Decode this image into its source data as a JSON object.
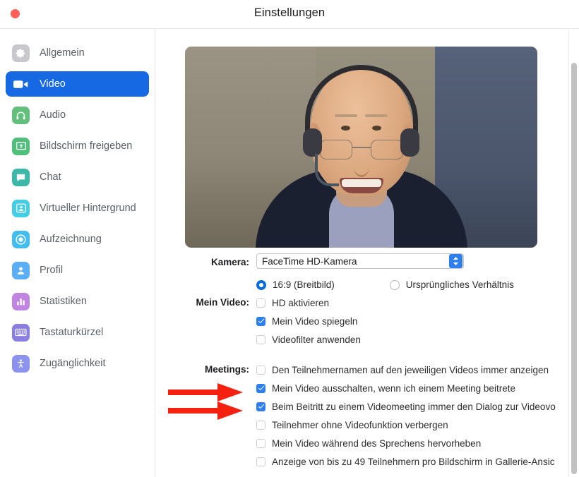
{
  "window": {
    "title": "Einstellungen",
    "close_button_label": "",
    "traffic_light_color": "#ff5f56"
  },
  "sidebar": {
    "items": [
      {
        "label": "Allgemein",
        "icon": "gear-icon",
        "color": "#c8c8cc",
        "active": false
      },
      {
        "label": "Video",
        "icon": "video-camera-icon",
        "color": "#1668e3",
        "active": true
      },
      {
        "label": "Audio",
        "icon": "headphones-icon",
        "color": "#62c07c",
        "active": false
      },
      {
        "label": "Bildschirm freigeben",
        "icon": "share-screen-icon",
        "color": "#4fc07a",
        "active": false
      },
      {
        "label": "Chat",
        "icon": "chat-bubble-icon",
        "color": "#3cb8a8",
        "active": false
      },
      {
        "label": "Virtueller Hintergrund",
        "icon": "virtual-background-icon",
        "color": "#42cfe6",
        "active": false
      },
      {
        "label": "Aufzeichnung",
        "icon": "record-icon",
        "color": "#41bdf0",
        "active": false
      },
      {
        "label": "Profil",
        "icon": "profile-icon",
        "color": "#5aaef5",
        "active": false
      },
      {
        "label": "Statistiken",
        "icon": "statistics-icon",
        "color": "#c085e0",
        "active": false
      },
      {
        "label": "Tastaturkürzel",
        "icon": "keyboard-icon",
        "color": "#8a7fe0",
        "active": false
      },
      {
        "label": "Zugänglichkeit",
        "icon": "accessibility-icon",
        "color": "#8b93ef",
        "active": false
      }
    ]
  },
  "main": {
    "video_preview": {
      "alt": "camera-preview"
    },
    "camera": {
      "label": "Kamera:",
      "selected": "FaceTime HD-Kamera"
    },
    "aspect_ratio": {
      "options": [
        {
          "label": "16:9 (Breitbild)",
          "checked": true
        },
        {
          "label": "Ursprüngliches Verhältnis",
          "checked": false
        }
      ]
    },
    "my_video": {
      "label": "Mein Video:",
      "checkboxes": [
        {
          "label": "HD aktivieren",
          "checked": false
        },
        {
          "label": "Mein Video spiegeln",
          "checked": true
        },
        {
          "label": "Videofilter anwenden",
          "checked": false
        }
      ]
    },
    "meetings": {
      "label": "Meetings:",
      "checkboxes": [
        {
          "label": "Den Teilnehmernamen auf den jeweiligen Videos immer anzeigen",
          "checked": false
        },
        {
          "label": "Mein Video ausschalten, wenn ich einem Meeting beitrete",
          "checked": true
        },
        {
          "label": "Beim Beitritt zu einem Videomeeting immer den Dialog zur Videovo",
          "checked": true
        },
        {
          "label": "Teilnehmer ohne Videofunktion verbergen",
          "checked": false
        },
        {
          "label": "Mein Video während des Sprechens hervorheben",
          "checked": false
        },
        {
          "label": "Anzeige von bis zu 49 Teilnehmern pro Bildschirm in Gallerie-Ansic",
          "checked": false
        }
      ]
    }
  },
  "annotations": {
    "color": "#f42110",
    "arrows": [
      {
        "name": "arrow-to-turn-off-my-video",
        "points_to": "Mein Video ausschalten, wenn ich einem Meeting beitrete"
      },
      {
        "name": "arrow-to-video-dialog",
        "points_to": "Beim Beitritt zu einem Videomeeting immer den Dialog zur Videovo"
      }
    ]
  },
  "scrollbar": {
    "name": "vertical-scrollbar"
  }
}
